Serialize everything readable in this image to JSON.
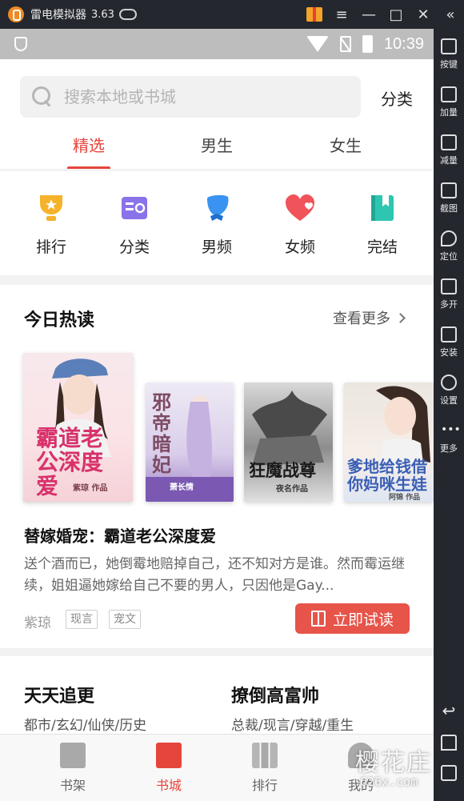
{
  "emulator": {
    "title": "雷电模拟器",
    "version": "3.63",
    "controls": {
      "minimize": "—",
      "maximize": "□",
      "close": "✕",
      "collapse": "«"
    }
  },
  "status_bar": {
    "time": "10:39"
  },
  "sidebar": {
    "items": [
      {
        "label": "按键",
        "icon": "keyboard-icon"
      },
      {
        "label": "加量",
        "icon": "volume-up-icon"
      },
      {
        "label": "减量",
        "icon": "volume-down-icon"
      },
      {
        "label": "截图",
        "icon": "scissors-icon"
      },
      {
        "label": "定位",
        "icon": "location-pin-icon"
      },
      {
        "label": "多开",
        "icon": "multi-instance-icon"
      },
      {
        "label": "安装",
        "icon": "apk-install-icon"
      },
      {
        "label": "设置",
        "icon": "gear-icon"
      },
      {
        "label": "更多",
        "icon": "more-dots-icon"
      }
    ]
  },
  "search": {
    "placeholder": "搜索本地或书城"
  },
  "header": {
    "category_label": "分类"
  },
  "tabs": [
    {
      "label": "精选",
      "active": true
    },
    {
      "label": "男生",
      "active": false
    },
    {
      "label": "女生",
      "active": false
    }
  ],
  "quick_entries": [
    {
      "label": "排行",
      "icon": "trophy-icon",
      "color": "#f6b22a"
    },
    {
      "label": "分类",
      "icon": "category-list-icon",
      "color": "#8a72e8"
    },
    {
      "label": "男频",
      "icon": "male-channel-icon",
      "color": "#3a93f0"
    },
    {
      "label": "女频",
      "icon": "heart-icon",
      "color": "#f0535a"
    },
    {
      "label": "完结",
      "icon": "bookmark-book-icon",
      "color": "#2ec6b0"
    }
  ],
  "hot_today": {
    "title": "今日热读",
    "more_label": "查看更多",
    "covers": [
      {
        "title": "霸道老公深度爱",
        "author_line": "紫琼 作品"
      },
      {
        "title": "邪帝暗妃",
        "author_line": "萧长情"
      },
      {
        "title": "狂魔战尊",
        "author_line": "夜名作品"
      },
      {
        "title": "爹地给钱借你妈咪生娃",
        "author_line": "阿锦 作品"
      }
    ],
    "featured": {
      "title": "替嫁婚宠：霸道老公深度爱",
      "description": "送个酒而已，她倒霉地赔掉自己，还不知对方是谁。然而霉运继续，姐姐逼她嫁给自己不要的男人，只因他是Gay...",
      "author": "紫琼",
      "tags": [
        "现言",
        "宠文"
      ],
      "read_label": "立即试读"
    }
  },
  "section3": [
    {
      "title": "天天追更",
      "subtitle": "都市/玄幻/仙侠/历史"
    },
    {
      "title": "撩倒高富帅",
      "subtitle": "总裁/现言/穿越/重生"
    }
  ],
  "bottom_nav": [
    {
      "label": "书架",
      "active": false
    },
    {
      "label": "书城",
      "active": true
    },
    {
      "label": "排行",
      "active": false
    },
    {
      "label": "我的",
      "active": false
    }
  ],
  "watermark": {
    "main": "樱花庄",
    "sub": "626x.com"
  },
  "colors": {
    "accent": "#e6453c",
    "button": "#e6544a"
  }
}
